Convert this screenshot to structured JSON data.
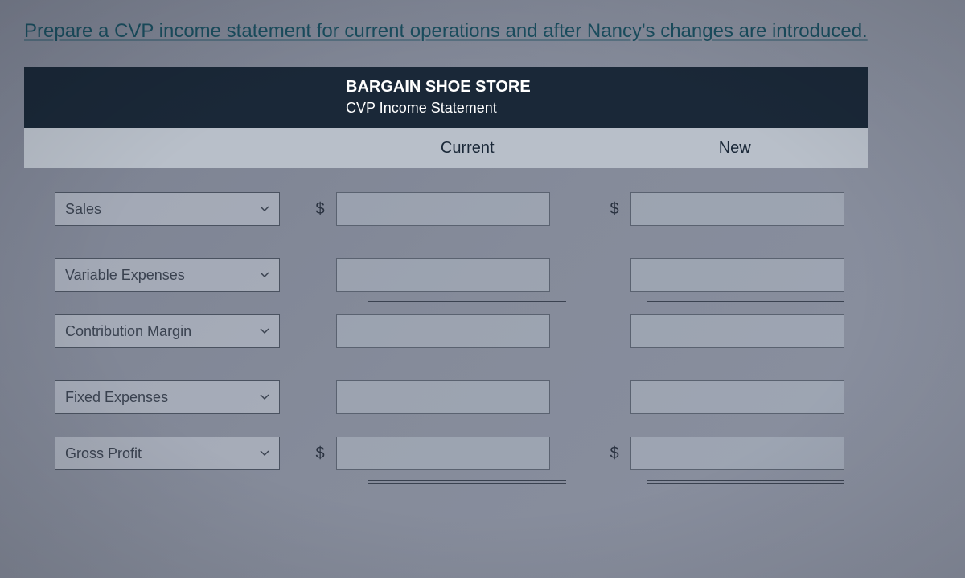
{
  "instruction": "Prepare a CVP income statement for current operations and after Nancy's changes are introduced.",
  "header": {
    "line1": "BARGAIN SHOE STORE",
    "line2": "CVP Income Statement"
  },
  "columns": {
    "current": "Current",
    "new": "New"
  },
  "currency_symbol": "$",
  "rows": [
    {
      "label": "Sales",
      "show_dollar": true,
      "line_after": false
    },
    {
      "label": "Variable Expenses",
      "show_dollar": false,
      "line_after": true
    },
    {
      "label": "Contribution Margin",
      "show_dollar": false,
      "line_after": false
    },
    {
      "label": "Fixed Expenses",
      "show_dollar": false,
      "line_after": true
    },
    {
      "label": "Gross Profit",
      "show_dollar": true,
      "line_after": false,
      "double_after": true
    }
  ],
  "values": {
    "current": [
      "",
      "",
      "",
      "",
      ""
    ],
    "new": [
      "",
      "",
      "",
      "",
      ""
    ]
  }
}
